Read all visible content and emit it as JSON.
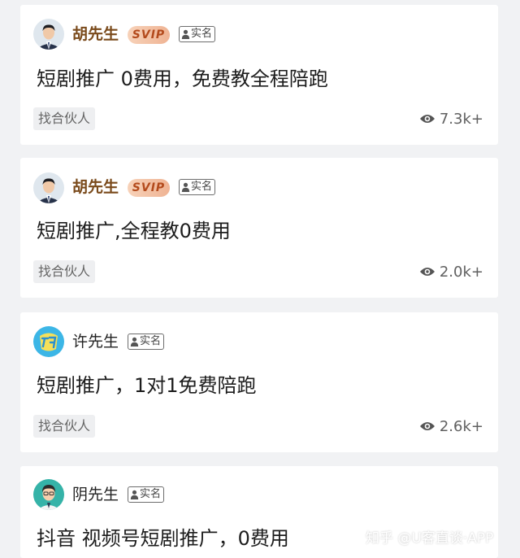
{
  "cards": [
    {
      "author": "胡先生",
      "svip": "SVIP",
      "verified": "实名",
      "title": "短剧推广 0费用，免费教全程陪跑",
      "tag": "找合伙人",
      "views": "7.3k+",
      "avatar": "man-suit-avatar"
    },
    {
      "author": "胡先生",
      "svip": "SVIP",
      "verified": "实名",
      "title": "短剧推广,全程教0费用",
      "tag": "找合伙人",
      "views": "2.0k+",
      "avatar": "man-suit-avatar"
    },
    {
      "author": "许先生",
      "verified": "实名",
      "title": "短剧推广，1对1免费陪跑",
      "tag": "找合伙人",
      "views": "2.6k+",
      "avatar": "logo-avatar"
    },
    {
      "author": "阴先生",
      "verified": "实名",
      "title": "抖音 视频号短剧推广，0费用",
      "avatar": "cartoon-man-avatar"
    }
  ],
  "watermark": "知乎 @U客直谈·APP",
  "colors": {
    "background": "#f1f2f4",
    "card": "#ffffff",
    "vip_name": "#7a4a1b",
    "svip_badge": "#efb393"
  }
}
